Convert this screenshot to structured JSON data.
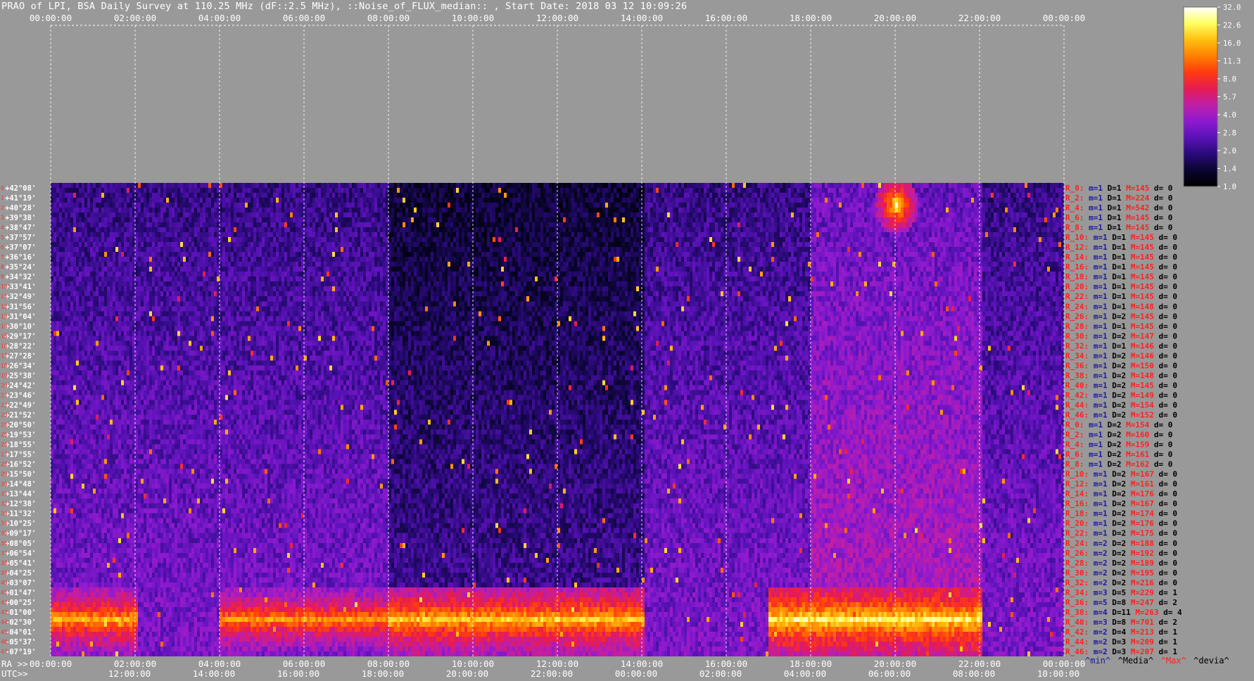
{
  "title": "PRAO of LPI, BSA Daily Survey at 110.25 MHz (dF::2.5 MHz), ::Noise_of_FLUX_median:: , Start Date: 2018 03 12 10:09:26",
  "chart_data": {
    "type": "heatmap",
    "title": "PRAO of LPI, BSA Daily Survey at 110.25 MHz (dF::2.5 MHz), ::Noise_of_FLUX_median:: , Start Date: 2018 03 12 10:09:26",
    "top_axis_ticks": [
      "00:00:00",
      "02:00:00",
      "04:00:00",
      "06:00:00",
      "08:00:00",
      "10:00:00",
      "12:00:00",
      "14:00:00",
      "16:00:00",
      "18:00:00",
      "20:00:00",
      "22:00:00",
      "00:00:00"
    ],
    "bottom_ra_label": "RA >>",
    "bottom_ra_ticks": [
      "00:00:00",
      "02:00:00",
      "04:00:00",
      "06:00:00",
      "08:00:00",
      "10:00:00",
      "12:00:00",
      "14:00:00",
      "16:00:00",
      "18:00:00",
      "20:00:00",
      "22:00:00",
      "00:00:00"
    ],
    "bottom_utc_label": "UTC>>",
    "bottom_utc_ticks": [
      "12:00:00",
      "14:00:00",
      "16:00:00",
      "18:00:00",
      "20:00:00",
      "22:00:00",
      "00:00:00",
      "02:00:00",
      "04:00:00",
      "06:00:00",
      "08:00:00",
      "10:00:00"
    ],
    "declinations": [
      "+42°08'",
      "+41°19'",
      "+40°28'",
      "+39°38'",
      "+38°47'",
      "+37°57'",
      "+37°07'",
      "+36°16'",
      "+35°24'",
      "+34°32'",
      "+33°41'",
      "+32°49'",
      "+31°56'",
      "+31°04'",
      "+30°10'",
      "+29°17'",
      "+28°22'",
      "+27°28'",
      "+26°34'",
      "+25°38'",
      "+24°42'",
      "+23°46'",
      "+22°49'",
      "+21°52'",
      "+20°50'",
      "+19°53'",
      "+18°55'",
      "+17°55'",
      "+16°52'",
      "+15°50'",
      "+14°48'",
      "+13°44'",
      "+12°38'",
      "+11°32'",
      "+10°25'",
      "+09°17'",
      "+08°05'",
      "+06°54'",
      "+05°41'",
      "+04°25'",
      "+03°07'",
      "+01°47'",
      "+00°25'",
      "-01°00'",
      "-02°30'",
      "-04°01'",
      "-05°37'",
      "-07°19'"
    ],
    "row_indices": [
      "0",
      "1",
      "2",
      "3",
      "4",
      "5",
      "6",
      "7",
      "8",
      "9",
      "10",
      "11",
      "12",
      "13",
      "14",
      "15",
      "16",
      "17",
      "18",
      "19",
      "20",
      "21",
      "22",
      "23",
      "24",
      "25",
      "26",
      "27",
      "28",
      "29",
      "30",
      "31",
      "32",
      "33",
      "34",
      "35",
      "36",
      "37",
      "38",
      "39",
      "40",
      "41",
      "42",
      "43",
      "44",
      "45",
      "46",
      "47"
    ],
    "beam_stats": [
      {
        "r": "R_0:",
        "m": "m=1",
        "D": "D=1",
        "M": "M=145",
        "d": "d= 0"
      },
      {
        "r": "R_2:",
        "m": "m=1",
        "D": "D=1",
        "M": "M=224",
        "d": "d= 0"
      },
      {
        "r": "R_4:",
        "m": "m=1",
        "D": "D=1",
        "M": "M=542",
        "d": "d= 0"
      },
      {
        "r": "R_6:",
        "m": "m=1",
        "D": "D=1",
        "M": "M=145",
        "d": "d= 0"
      },
      {
        "r": "R_8:",
        "m": "m=1",
        "D": "D=1",
        "M": "M=145",
        "d": "d= 0"
      },
      {
        "r": "R_10:",
        "m": "m=1",
        "D": "D=1",
        "M": "M=145",
        "d": "d= 0"
      },
      {
        "r": "R_12:",
        "m": "m=1",
        "D": "D=1",
        "M": "M=145",
        "d": "d= 0"
      },
      {
        "r": "R_14:",
        "m": "m=1",
        "D": "D=1",
        "M": "M=145",
        "d": "d= 0"
      },
      {
        "r": "R_16:",
        "m": "m=1",
        "D": "D=1",
        "M": "M=145",
        "d": "d= 0"
      },
      {
        "r": "R_18:",
        "m": "m=1",
        "D": "D=1",
        "M": "M=145",
        "d": "d= 0"
      },
      {
        "r": "R_20:",
        "m": "m=1",
        "D": "D=1",
        "M": "M=145",
        "d": "d= 0"
      },
      {
        "r": "R_22:",
        "m": "m=1",
        "D": "D=1",
        "M": "M=145",
        "d": "d= 0"
      },
      {
        "r": "R_24:",
        "m": "m=1",
        "D": "D=1",
        "M": "M=148",
        "d": "d= 0"
      },
      {
        "r": "R_26:",
        "m": "m=1",
        "D": "D=2",
        "M": "M=145",
        "d": "d= 0"
      },
      {
        "r": "R_28:",
        "m": "m=1",
        "D": "D=1",
        "M": "M=145",
        "d": "d= 0"
      },
      {
        "r": "R_30:",
        "m": "m=1",
        "D": "D=2",
        "M": "M=147",
        "d": "d= 0"
      },
      {
        "r": "R_32:",
        "m": "m=1",
        "D": "D=1",
        "M": "M=146",
        "d": "d= 0"
      },
      {
        "r": "R_34:",
        "m": "m=1",
        "D": "D=2",
        "M": "M=146",
        "d": "d= 0"
      },
      {
        "r": "R_36:",
        "m": "m=1",
        "D": "D=2",
        "M": "M=150",
        "d": "d= 0"
      },
      {
        "r": "R_38:",
        "m": "m=1",
        "D": "D=2",
        "M": "M=148",
        "d": "d= 0"
      },
      {
        "r": "R_40:",
        "m": "m=1",
        "D": "D=2",
        "M": "M=145",
        "d": "d= 0"
      },
      {
        "r": "R_42:",
        "m": "m=1",
        "D": "D=2",
        "M": "M=149",
        "d": "d= 0"
      },
      {
        "r": "R_44:",
        "m": "m=1",
        "D": "D=2",
        "M": "M=154",
        "d": "d= 0"
      },
      {
        "r": "R_46:",
        "m": "m=1",
        "D": "D=2",
        "M": "M=152",
        "d": "d= 0"
      },
      {
        "r": "R_0:",
        "m": "m=1",
        "D": "D=2",
        "M": "M=154",
        "d": "d= 0"
      },
      {
        "r": "R_2:",
        "m": "m=1",
        "D": "D=2",
        "M": "M=160",
        "d": "d= 0"
      },
      {
        "r": "R_4:",
        "m": "m=1",
        "D": "D=2",
        "M": "M=159",
        "d": "d= 0"
      },
      {
        "r": "R_6:",
        "m": "m=1",
        "D": "D=2",
        "M": "M=161",
        "d": "d= 0"
      },
      {
        "r": "R_8:",
        "m": "m=1",
        "D": "D=2",
        "M": "M=162",
        "d": "d= 0"
      },
      {
        "r": "R_10:",
        "m": "m=1",
        "D": "D=2",
        "M": "M=167",
        "d": "d= 0"
      },
      {
        "r": "R_12:",
        "m": "m=1",
        "D": "D=2",
        "M": "M=161",
        "d": "d= 0"
      },
      {
        "r": "R_14:",
        "m": "m=1",
        "D": "D=2",
        "M": "M=176",
        "d": "d= 0"
      },
      {
        "r": "R_16:",
        "m": "m=1",
        "D": "D=2",
        "M": "M=167",
        "d": "d= 0"
      },
      {
        "r": "R_18:",
        "m": "m=1",
        "D": "D=2",
        "M": "M=174",
        "d": "d= 0"
      },
      {
        "r": "R_20:",
        "m": "m=1",
        "D": "D=2",
        "M": "M=176",
        "d": "d= 0"
      },
      {
        "r": "R_22:",
        "m": "m=1",
        "D": "D=2",
        "M": "M=175",
        "d": "d= 0"
      },
      {
        "r": "R_24:",
        "m": "m=2",
        "D": "D=2",
        "M": "M=188",
        "d": "d= 0"
      },
      {
        "r": "R_26:",
        "m": "m=2",
        "D": "D=2",
        "M": "M=192",
        "d": "d= 0"
      },
      {
        "r": "R_28:",
        "m": "m=2",
        "D": "D=2",
        "M": "M=189",
        "d": "d= 0"
      },
      {
        "r": "R_30:",
        "m": "m=2",
        "D": "D=2",
        "M": "M=195",
        "d": "d= 0"
      },
      {
        "r": "R_32:",
        "m": "m=2",
        "D": "D=2",
        "M": "M=216",
        "d": "d= 0"
      },
      {
        "r": "R_34:",
        "m": "m=3",
        "D": "D=5",
        "M": "M=229",
        "d": "d= 1"
      },
      {
        "r": "R_36:",
        "m": "m=5",
        "D": "D=8",
        "M": "M=247",
        "d": "d= 2"
      },
      {
        "r": "R_38:",
        "m": "m=4",
        "D": "D=11",
        "M": "M=263",
        "d": "d= 4"
      },
      {
        "r": "R_40:",
        "m": "m=3",
        "D": "D=8",
        "M": "M=701",
        "d": "d= 2"
      },
      {
        "r": "R_42:",
        "m": "m=2",
        "D": "D=4",
        "M": "M=213",
        "d": "d= 1"
      },
      {
        "r": "R_44:",
        "m": "m=2",
        "D": "D=3",
        "M": "M=209",
        "d": "d= 1"
      },
      {
        "r": "R_46:",
        "m": "m=2",
        "D": "D=3",
        "M": "M=207",
        "d": "d= 1"
      }
    ],
    "stat_legend": [
      {
        "label": "^min^",
        "color": "#1a1aa0"
      },
      {
        "label": "^Media^",
        "color": "#000000"
      },
      {
        "label": "^Max^",
        "color": "#ff2020"
      },
      {
        "label": "^devia^",
        "color": "#000000"
      }
    ],
    "colorbar_ticks": [
      "32.0",
      "22.6",
      "16.0",
      "11.3",
      "8.0",
      "5.7",
      "4.0",
      "2.8",
      "2.0",
      "1.4",
      "1.0"
    ],
    "colorbar_scale": "log",
    "colorbar_range": [
      1.0,
      32.0
    ],
    "colormap": [
      "#000000",
      "#0a0530",
      "#2a0a7a",
      "#5a12b8",
      "#8e1ad0",
      "#c01ea8",
      "#e61b52",
      "#ff3a10",
      "#ff8000",
      "#ffc010",
      "#ffff60",
      "#ffffff"
    ],
    "intensity_features": [
      {
        "feature": "galactic plane band, low declinations (-07°19' .. +01°47')",
        "ra_range": [
          "00:00:00",
          "02:00:00"
        ],
        "level": 16.0
      },
      {
        "feature": "galactic plane band, low declinations (-07°19' .. +01°47')",
        "ra_range": [
          "04:00:00",
          "08:00:00"
        ],
        "level": 14.0
      },
      {
        "feature": "galactic plane band, low declinations (-07°19' .. +01°47')",
        "ra_range": [
          "08:00:00",
          "14:00:00"
        ],
        "level": 18.0
      },
      {
        "feature": "galactic plane band, low declinations (-07°19' .. +01°47')",
        "ra_range": [
          "17:00:00",
          "22:00:00"
        ],
        "level": 22.6
      },
      {
        "feature": "Cygnus region",
        "ra": "20:00:00",
        "dec": "+40°28'",
        "level": 32.0
      },
      {
        "feature": "sky background",
        "ra_range": [
          "08:00:00",
          "14:00:00"
        ],
        "level": 1.4
      },
      {
        "feature": "sky background",
        "ra_range": [
          "18:00:00",
          "22:00:00"
        ],
        "level": 2.8
      }
    ],
    "grid": true
  }
}
